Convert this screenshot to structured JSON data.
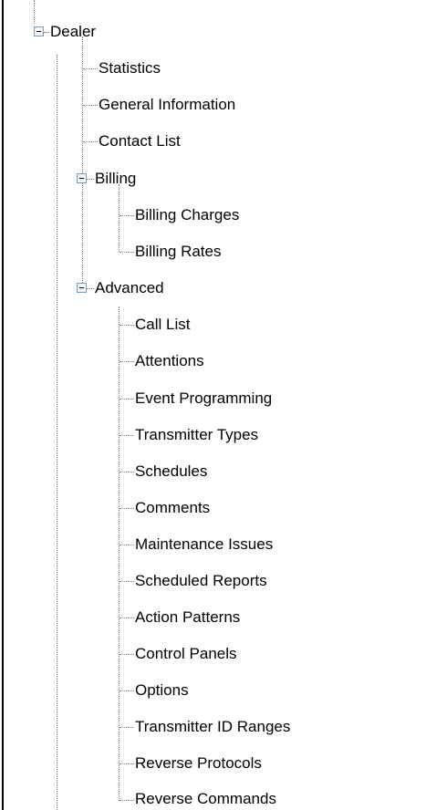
{
  "tree": {
    "root": {
      "label": "Dealer",
      "children": {
        "statistics": "Statistics",
        "general_information": "General Information",
        "contact_list": "Contact List",
        "billing": {
          "label": "Billing",
          "children": [
            "Billing Charges",
            "Billing Rates"
          ]
        },
        "advanced": {
          "label": "Advanced",
          "children": [
            "Call List",
            "Attentions",
            "Event Programming",
            "Transmitter Types",
            "Schedules",
            "Comments",
            "Maintenance Issues",
            "Scheduled Reports",
            "Action Patterns",
            "Control Panels",
            "Options",
            "Transmitter ID Ranges",
            "Reverse Protocols",
            "Reverse Commands"
          ]
        }
      }
    }
  },
  "colors": {
    "connector": "#7a7a7a",
    "toggle_border": "#7f9db9",
    "text": "#000000"
  },
  "icons": {
    "expanded": "minus-box-icon"
  }
}
